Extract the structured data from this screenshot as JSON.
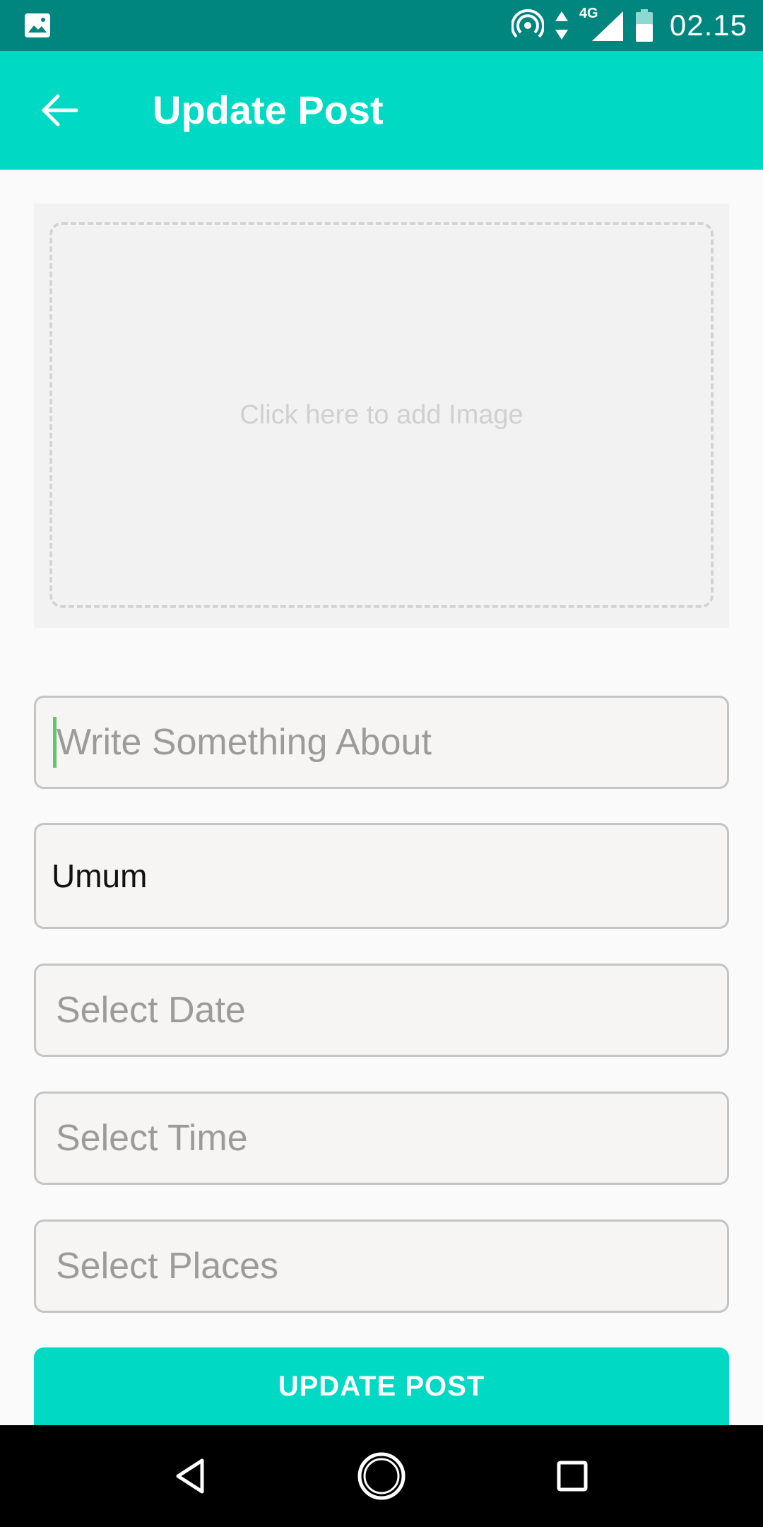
{
  "status_bar": {
    "time": "02.15",
    "network": "4G",
    "icons": [
      "gallery-icon",
      "hotspot-icon",
      "data-arrows-icon",
      "signal-icon",
      "battery-icon"
    ]
  },
  "app_bar": {
    "title": "Update Post",
    "back_icon": "arrow-back-icon",
    "color": "#00d9c3"
  },
  "image_picker": {
    "hint": "Click here to add Image"
  },
  "form": {
    "description": {
      "value": "",
      "placeholder": "Write Something About"
    },
    "category": {
      "value": "Umum"
    },
    "date": {
      "value": "",
      "placeholder": "Select Date"
    },
    "time": {
      "value": "",
      "placeholder": "Select Time"
    },
    "place": {
      "value": "",
      "placeholder": "Select Places"
    }
  },
  "submit": {
    "label": "UPDATE POST"
  },
  "nav_bar": {
    "icons": [
      "back-triangle-icon",
      "home-circle-icon",
      "recents-square-icon"
    ]
  }
}
